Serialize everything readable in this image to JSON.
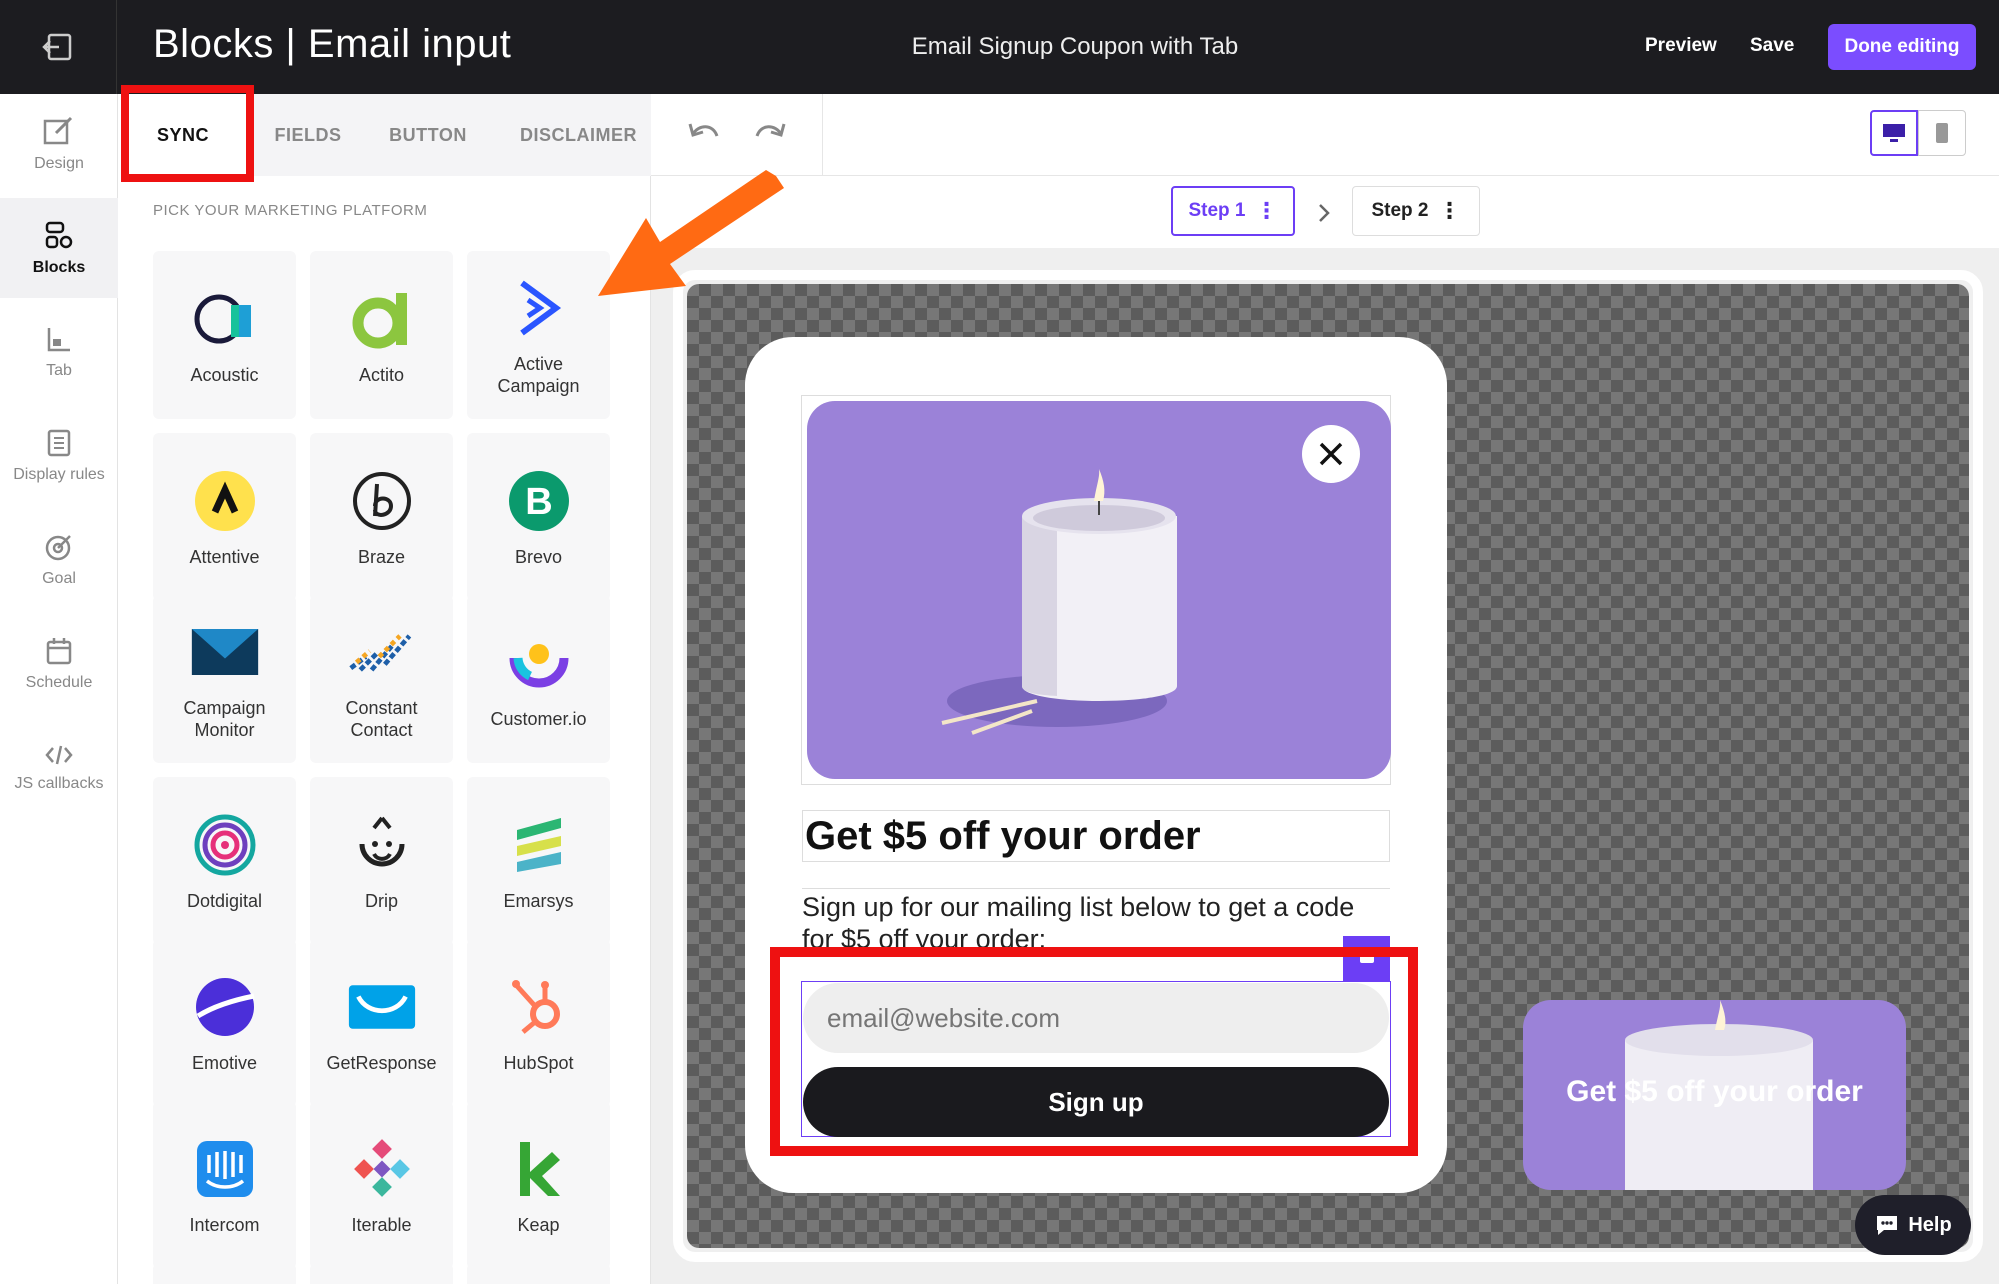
{
  "header": {
    "title": "Blocks | Email input",
    "campaign_name": "Email Signup Coupon with Tab",
    "preview": "Preview",
    "save": "Save",
    "done": "Done editing"
  },
  "rail": {
    "items": [
      {
        "label": "Design",
        "icon": "design-icon"
      },
      {
        "label": "Blocks",
        "icon": "blocks-icon"
      },
      {
        "label": "Tab",
        "icon": "tab-icon"
      },
      {
        "label": "Display rules",
        "icon": "display-rules-icon"
      },
      {
        "label": "Goal",
        "icon": "goal-icon"
      },
      {
        "label": "Schedule",
        "icon": "schedule-icon"
      },
      {
        "label": "JS callbacks",
        "icon": "code-icon"
      }
    ],
    "active": "Blocks"
  },
  "panel": {
    "tabs": [
      "SYNC",
      "FIELDS",
      "BUTTON",
      "DISCLAIMER"
    ],
    "active_tab": "SYNC",
    "section_label": "PICK YOUR MARKETING PLATFORM",
    "platforms": [
      {
        "name": "Acoustic"
      },
      {
        "name": "Actito"
      },
      {
        "name": "Active Campaign"
      },
      {
        "name": "Attentive"
      },
      {
        "name": "Braze"
      },
      {
        "name": "Brevo"
      },
      {
        "name": "Campaign Monitor"
      },
      {
        "name": "Constant Contact"
      },
      {
        "name": "Customer.io"
      },
      {
        "name": "Dotdigital"
      },
      {
        "name": "Drip"
      },
      {
        "name": "Emarsys"
      },
      {
        "name": "Emotive"
      },
      {
        "name": "GetResponse"
      },
      {
        "name": "HubSpot"
      },
      {
        "name": "Intercom"
      },
      {
        "name": "Iterable"
      },
      {
        "name": "Keap"
      }
    ]
  },
  "steps": {
    "step1": "Step 1",
    "step2": "Step 2",
    "active": "Step 1"
  },
  "popup": {
    "headline": "Get $5 off your order",
    "subtext": "Sign up for our mailing list below to get a code for $5 off your order:",
    "email_placeholder": "email@website.com",
    "signup_label": "Sign up"
  },
  "teaser": {
    "text": "Get $5 off your order"
  },
  "help": {
    "label": "Help"
  },
  "colors": {
    "accent": "#7b4dff",
    "highlight": "#ee1111",
    "arrow": "#ff6a13",
    "hero": "#9b82d8"
  }
}
